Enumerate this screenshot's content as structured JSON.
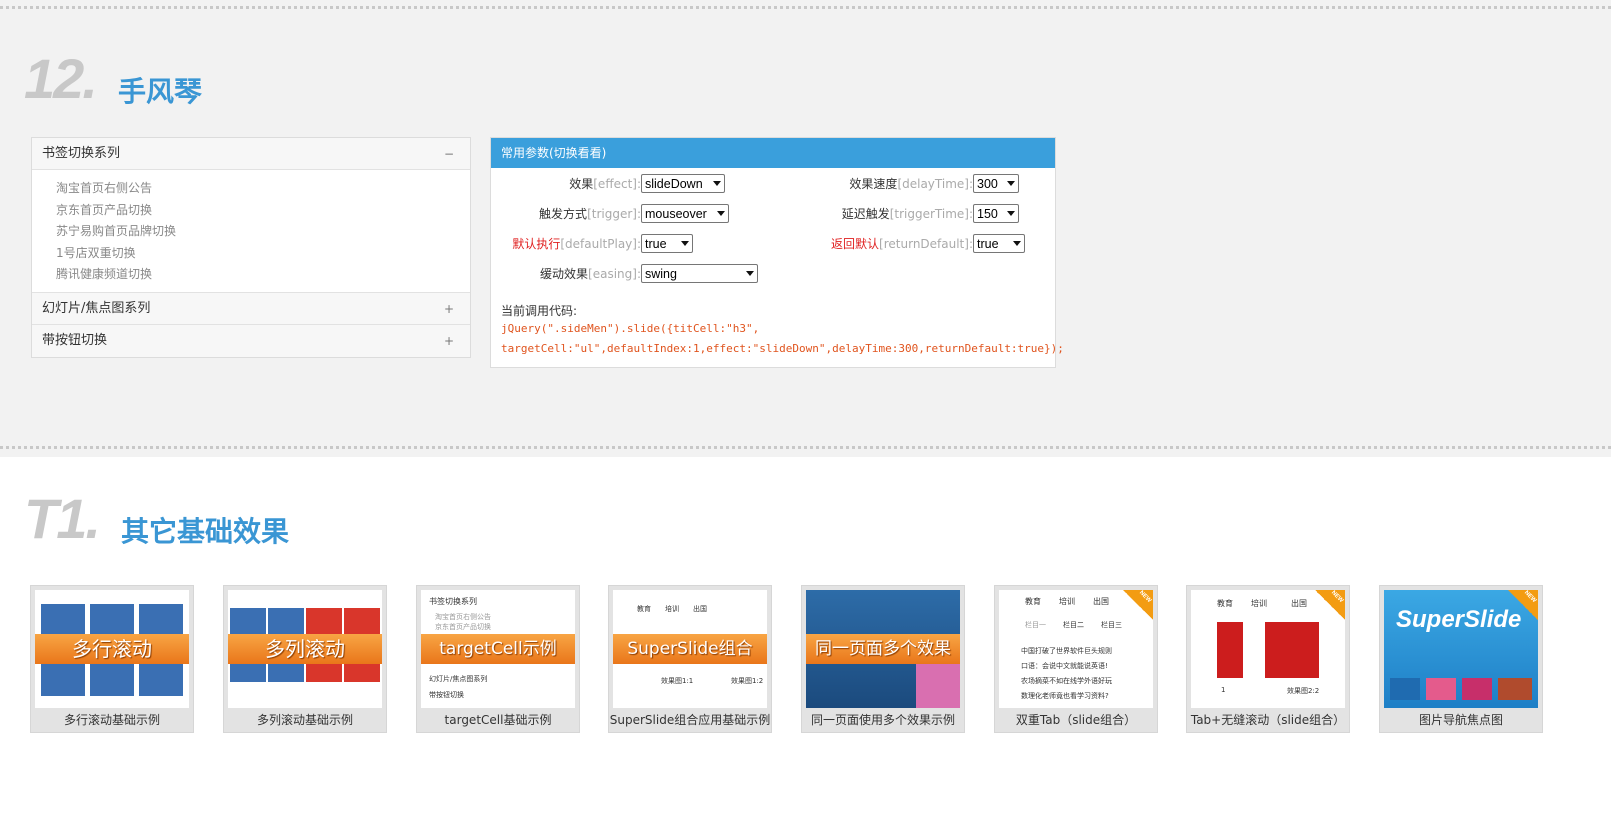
{
  "section12": {
    "number": "12.",
    "title": "手风琴"
  },
  "accordion": {
    "groups": [
      {
        "label": "书签切换系列",
        "sign": "−",
        "items": [
          "淘宝首页右侧公告",
          "京东首页产品切换",
          "苏宁易购首页品牌切换",
          "1号店双重切换",
          "腾讯健康频道切换"
        ]
      },
      {
        "label": "幻灯片/焦点图系列",
        "sign": "+"
      },
      {
        "label": "带按钮切换",
        "sign": "+"
      }
    ]
  },
  "params": {
    "title": "常用参数(切换看看)",
    "effect": {
      "cn": "效果",
      "en": "[effect]:",
      "value": "slideDown"
    },
    "trigger": {
      "cn": "触发方式",
      "en": "[trigger]:",
      "value": "mouseover"
    },
    "defaultPlay": {
      "cn": "默认执行",
      "en": "[defaultPlay]:",
      "value": "true"
    },
    "easing": {
      "cn": "缓动效果",
      "en": "[easing]:",
      "value": "swing"
    },
    "delayTime": {
      "cn": "效果速度",
      "en": "[delayTime]:",
      "value": "300"
    },
    "triggerTime": {
      "cn": "延迟触发",
      "en": "[triggerTime]:",
      "value": "150"
    },
    "returnDefault": {
      "cn": "返回默认",
      "en": "[returnDefault]:",
      "value": "true"
    },
    "code_label": "当前调用代码:",
    "code_line1": "jQuery(\".sideMen\").slide({titCell:\"h3\",",
    "code_line2": "targetCell:\"ul\",defaultIndex:1,effect:\"slideDown\",delayTime:300,returnDefault:true});"
  },
  "sectionT1": {
    "number": "T1.",
    "title": "其它基础效果"
  },
  "thumbs": [
    {
      "banner": "多行滚动",
      "caption": "多行滚动基础示例"
    },
    {
      "banner": "多列滚动",
      "caption": "多列滚动基础示例"
    },
    {
      "banner": "targetCell示例",
      "caption": "targetCell基础示例",
      "sub": [
        "书签切换系列",
        "淘宝首页右侧公告",
        "京东首页产品切换",
        "幻灯片/焦点图系列",
        "带按钮切换"
      ]
    },
    {
      "banner": "SuperSlide组合",
      "caption": "SuperSlide组合应用基础示例",
      "sub": [
        "教育",
        "培训",
        "出国",
        "效果图1:1",
        "效果图1:2"
      ]
    },
    {
      "banner": "同一页面多个效果",
      "caption": "同一页面使用多个效果示例"
    },
    {
      "caption": "双重Tab（slide组合）",
      "tabs": [
        "教育",
        "培训",
        "出国"
      ],
      "subtabs": [
        "栏目一",
        "栏目二",
        "栏目三"
      ],
      "lines": [
        "中国打破了世界软件巨头规则",
        "口语：会说中文就能说英语!",
        "农场摘菜不如在线学外语好玩",
        "数理化老师竟也看学习资料?"
      ],
      "badge": "NEW"
    },
    {
      "caption": "Tab+无缝滚动（slide组合）",
      "tabs": [
        "教育",
        "培训",
        "出国"
      ],
      "lines": [
        "1",
        "效果图2:2"
      ],
      "badge": "NEW"
    },
    {
      "caption": "图片导航焦点图",
      "logo": "SuperSlide",
      "badge": "NEW"
    }
  ],
  "colors": {
    "accent": "#3a96d4",
    "header_blue": "#3a9fdc",
    "code_orange": "#e0541e",
    "red": "#e02020",
    "banner_orange": "#f28a26"
  }
}
